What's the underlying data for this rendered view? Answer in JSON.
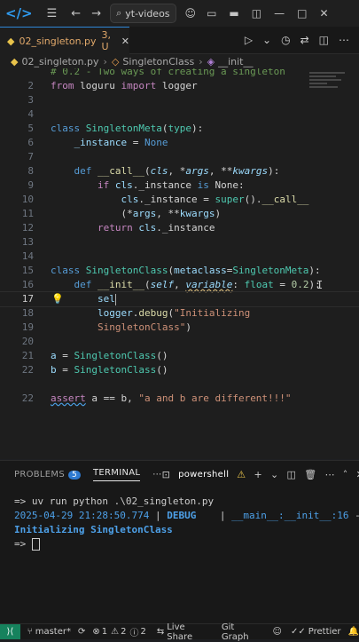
{
  "titlebar": {
    "search_label": "yt-videos"
  },
  "tab": {
    "filename": "02_singleton.py",
    "problems": "3, U"
  },
  "breadcrumb": {
    "file": "02_singleton.py",
    "class": "SingletonClass",
    "method": "__init__"
  },
  "line_numbers": [
    "",
    "2",
    "3",
    "4",
    "5",
    "6",
    "7",
    "8",
    "9",
    "10",
    "11",
    "12",
    "13",
    "14",
    "15",
    "16",
    "17",
    "18",
    "19",
    "20",
    "21",
    "22"
  ],
  "code": {
    "l1": "# 0.2 - Two ways of creating a singleton",
    "l2_kw1": "from",
    "l2_mod": "loguru",
    "l2_kw2": "import",
    "l2_name": "logger",
    "l5_kw": "class",
    "l5_name": "SingletonMeta",
    "l5_open": "(",
    "l5_base": "type",
    "l5_close": "):",
    "l6_name": "_instance",
    "l6_eq": " = ",
    "l6_val": "None",
    "l8_kw": "def",
    "l8_fn": "__call__",
    "l8_p1": "(",
    "l8_a1": "cls",
    "l8_s1": ", *",
    "l8_a2": "args",
    "l8_s2": ", **",
    "l8_a3": "kwargs",
    "l8_end": "):",
    "l9_kw": "if",
    "l9_a": "cls",
    "l9_b": "._instance ",
    "l9_kw2": "is",
    "l9_c": " None:",
    "l10_a": "cls",
    "l10_b": "._instance = ",
    "l10_fn": "super",
    "l10_c": "().",
    "l10_fn2": "__call__",
    "l11_a": "(*",
    "l11_b": "args",
    "l11_c": ", **",
    "l11_d": "kwargs",
    "l11_e": ")",
    "l12_kw": "return",
    "l12_a": "cls",
    "l12_b": "._instance",
    "l14_kw": "class",
    "l14_name": "SingletonClass",
    "l14_open": "(",
    "l14_p": "metaclass",
    "l14_eq": "=",
    "l14_meta": "SingletonMeta",
    "l14_close": "):",
    "l15_kw": "def",
    "l15_fn": "__init__",
    "l15_open": "(",
    "l15_self": "self",
    "l15_c": ", ",
    "l15_var": "variable",
    "l15_colon": ": ",
    "l15_type": "float",
    "l15_eq": " = ",
    "l15_num": "0.2",
    "l15_close": "):",
    "l16_text": "sel",
    "l17_a": "logger",
    "l17_b": ".",
    "l17_fn": "debug",
    "l17_c": "(",
    "l17_str": "\"Initializing",
    "l18_str": "SingletonClass\"",
    "l18_c": ")",
    "l19_a": "a",
    "l19_b": " = ",
    "l19_cls": "SingletonClass",
    "l19_c": "()",
    "l20_a": "b",
    "l20_b": " = ",
    "l20_cls": "SingletonClass",
    "l20_c": "()",
    "l22_kw": "assert",
    "l22_a": " a == b, ",
    "l22_str": "\"a and b are different!!!\""
  },
  "panel": {
    "problems_label": "PROBLEMS",
    "problems_count": "5",
    "terminal_label": "TERMINAL",
    "shell_label": "powershell"
  },
  "terminal": {
    "line1_prompt": "=>",
    "line1_cmd": " uv run python .\\02_singleton.py",
    "line2_date": "2025-04-29 21:28:50.774",
    "line2_sep1": " | ",
    "line2_level": "DEBUG",
    "line2_sep2": "    | ",
    "line2_mod": "__main__:__init__:16",
    "line2_dash": " -",
    "line3_msg": "Initializing SingletonClass",
    "line4_prompt": "=>"
  },
  "status": {
    "branch": "master*",
    "errors": "1",
    "warnings": "2",
    "info": "2",
    "live_share": "Live Share",
    "git_graph": "Git Graph",
    "prettier": "Prettier"
  },
  "colors": {
    "accent": "#2f87d6",
    "remote_bg": "#16825d",
    "editor_bg": "#1e1e1e"
  }
}
